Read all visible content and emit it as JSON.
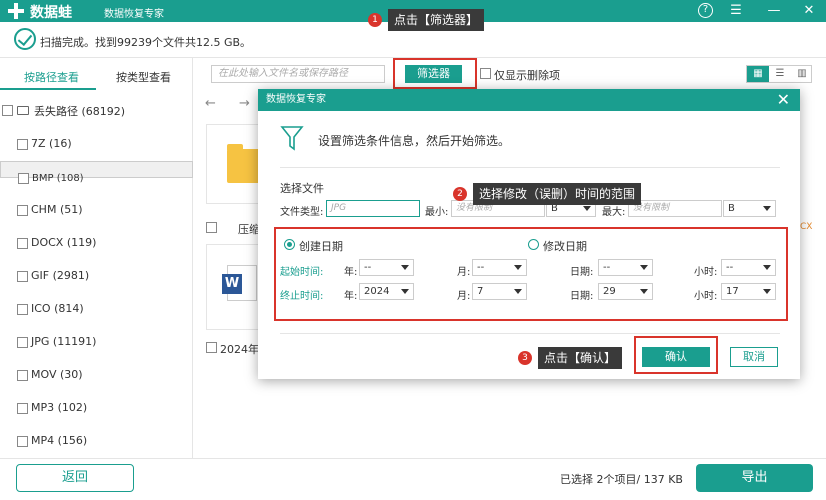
{
  "titlebar": {
    "app_name": "数据蛙",
    "app_sub": "数据恢复专家",
    "help": "?",
    "menu": "☰",
    "minimize": "—",
    "close": "✕"
  },
  "status": {
    "scan_text": "扫描完成。找到99239个文件共12.5 GB。"
  },
  "left": {
    "tab_path": "按路径查看",
    "tab_type": "按类型查看",
    "root": "丢失路径 (68192)",
    "items": [
      {
        "label": "7Z (16)"
      },
      {
        "label": "BMP (108)"
      },
      {
        "label": "CHM (51)"
      },
      {
        "label": "DOCX (119)"
      },
      {
        "label": "GIF (2981)"
      },
      {
        "label": "ICO (814)"
      },
      {
        "label": "JPG (11191)"
      },
      {
        "label": "MOV (30)"
      },
      {
        "label": "MP3 (102)"
      },
      {
        "label": "MP4 (156)"
      }
    ]
  },
  "toolbar": {
    "search_placeholder": "在此处输入文件名或保存路径",
    "filter_label": "筛选器",
    "only_deleted": "仅显示删除项"
  },
  "content": {
    "compress_label": "压缩",
    "date_label": "2024年...",
    "docx_suffix": "CX",
    "word_letter": "W"
  },
  "bottom": {
    "back": "返回",
    "selected_info": "已选择 2个项目/ 137 KB",
    "export": "导出"
  },
  "dialog": {
    "title": "数据恢复专家",
    "close": "✕",
    "desc": "设置筛选条件信息，然后开始筛选。",
    "select_file": "选择文件",
    "file_type_label": "文件类型:",
    "file_type_placeholder": "JPG",
    "min_size_label": "最小:",
    "min_size_placeholder": "没有限制",
    "min_unit": "B",
    "max_size_label": "最大:",
    "max_size_placeholder": "没有限制",
    "max_unit": "B",
    "create_date": "创建日期",
    "modify_date": "修改日期",
    "start_time_label": "起始时间:",
    "end_time_label": "终止时间:",
    "year_label": "年:",
    "month_label": "月:",
    "day_label": "日期:",
    "hour_label": "小时:",
    "start": {
      "year": "--",
      "month": "--",
      "day": "--",
      "hour": "--"
    },
    "end": {
      "year": "2024",
      "month": "7",
      "day": "29",
      "hour": "17"
    },
    "ok": "确认",
    "cancel": "取消"
  },
  "callouts": [
    {
      "num": "1",
      "text": "点击【筛选器】"
    },
    {
      "num": "2",
      "text": "选择修改（误删）时间的范围"
    },
    {
      "num": "3",
      "text": "点击【确认】"
    }
  ],
  "colors": {
    "accent": "#1a9e8f",
    "highlight": "#d9342b"
  }
}
